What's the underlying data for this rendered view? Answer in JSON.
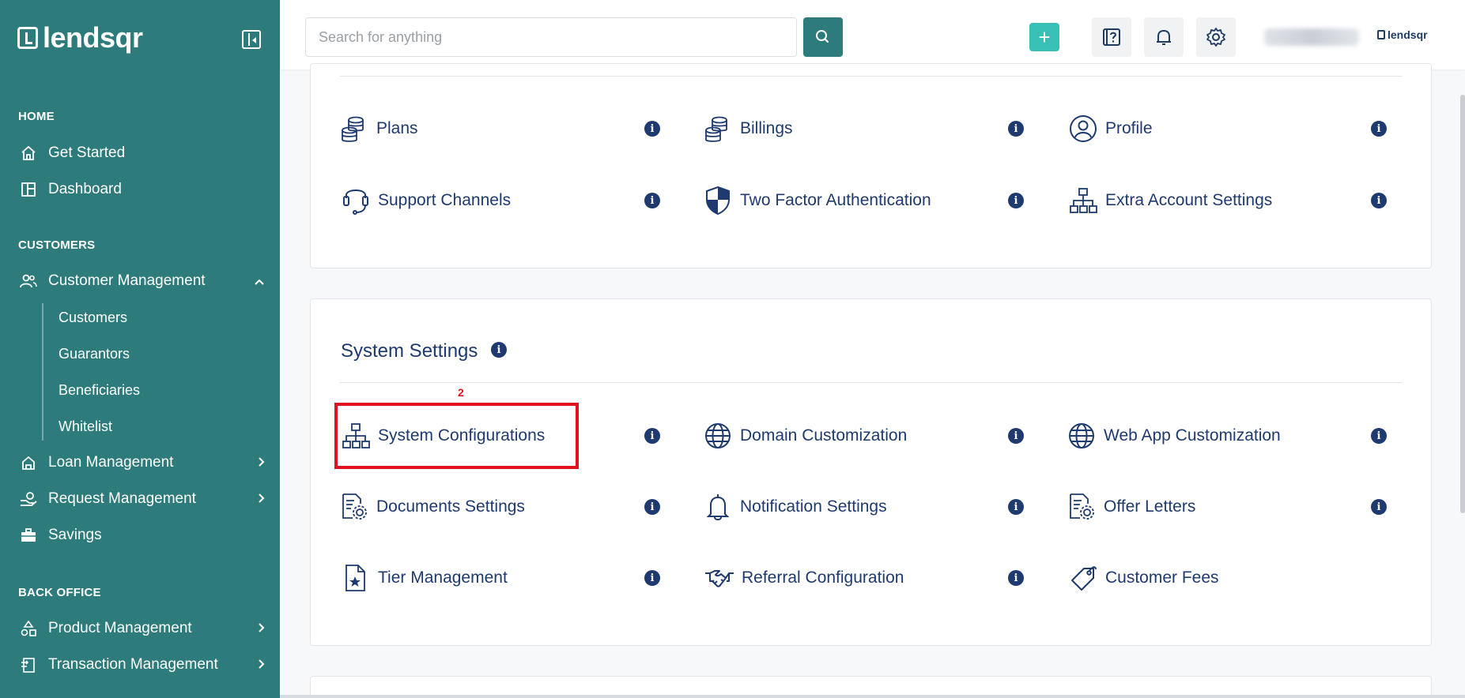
{
  "brand": {
    "name": "lendsqr"
  },
  "sidebar": {
    "sections": [
      {
        "label": "HOME"
      },
      {
        "label": "CUSTOMERS"
      },
      {
        "label": "BACK OFFICE"
      }
    ],
    "items": [
      {
        "label": "Get Started",
        "icon": "home-icon"
      },
      {
        "label": "Dashboard",
        "icon": "dashboard-icon"
      },
      {
        "label": "Customer Management",
        "icon": "users-icon"
      },
      {
        "label": "Loan Management",
        "icon": "loan-icon"
      },
      {
        "label": "Request Management",
        "icon": "request-icon"
      },
      {
        "label": "Savings",
        "icon": "briefcase-icon"
      },
      {
        "label": "Product Management",
        "icon": "product-icon"
      },
      {
        "label": "Transaction Management",
        "icon": "transaction-icon"
      }
    ],
    "sub_items": [
      {
        "label": "Customers"
      },
      {
        "label": "Guarantors"
      },
      {
        "label": "Beneficiaries"
      },
      {
        "label": "Whitelist"
      }
    ]
  },
  "header": {
    "search_placeholder": "Search for anything",
    "plus_label": "+",
    "brand_small": "lendsqr"
  },
  "account_settings": {
    "items": [
      {
        "label": "Plans",
        "icon": "coins-icon"
      },
      {
        "label": "Billings",
        "icon": "coins-icon"
      },
      {
        "label": "Profile",
        "icon": "profile-icon"
      },
      {
        "label": "Support Channels",
        "icon": "headset-icon"
      },
      {
        "label": "Two Factor Authentication",
        "icon": "shield-icon"
      },
      {
        "label": "Extra Account Settings",
        "icon": "hierarchy-icon"
      }
    ]
  },
  "system_settings": {
    "title": "System Settings",
    "highlight_number": "2",
    "items": [
      {
        "label": "System Configurations",
        "icon": "hierarchy-icon"
      },
      {
        "label": "Domain Customization",
        "icon": "globe-icon"
      },
      {
        "label": "Web App Customization",
        "icon": "globe-icon"
      },
      {
        "label": "Documents Settings",
        "icon": "document-gear-icon"
      },
      {
        "label": "Notification Settings",
        "icon": "bell-icon"
      },
      {
        "label": "Offer Letters",
        "icon": "document-gear-icon"
      },
      {
        "label": "Tier Management",
        "icon": "star-document-icon"
      },
      {
        "label": "Referral Configuration",
        "icon": "handshake-icon"
      },
      {
        "label": "Customer Fees",
        "icon": "tag-icon"
      }
    ]
  },
  "colors": {
    "sidebar": "#2d7b7b",
    "accent": "#39c0b6",
    "text": "#1e3a6e",
    "highlight": "#e0121f"
  }
}
